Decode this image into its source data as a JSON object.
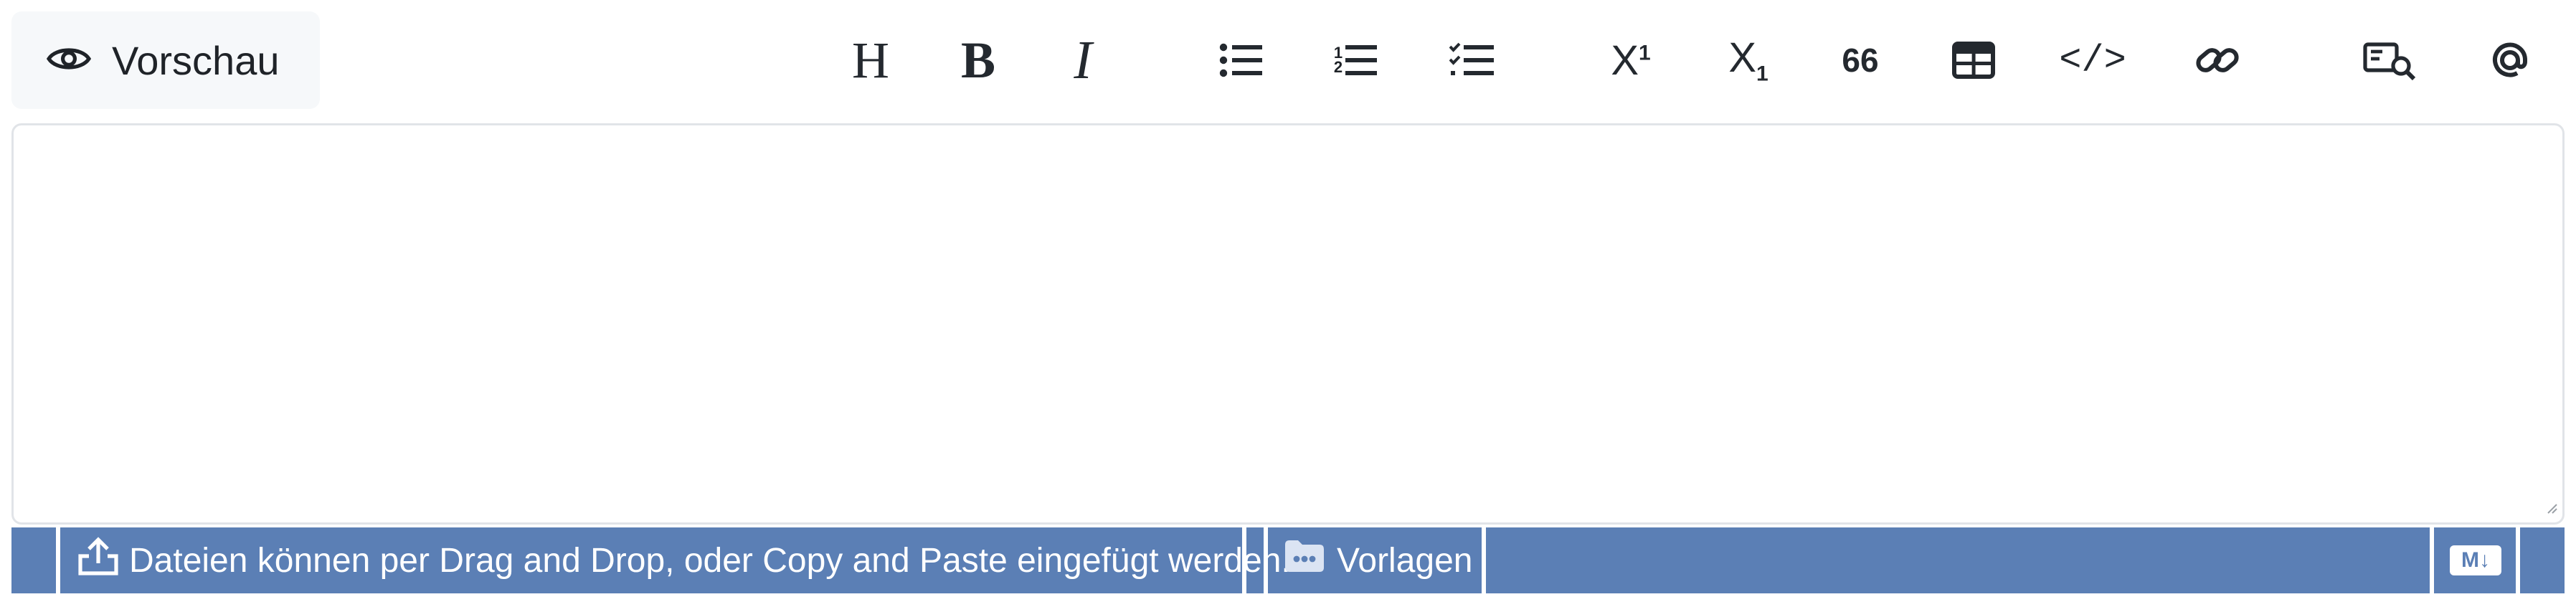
{
  "preview": {
    "label": "Vorschau",
    "icon": "eye-icon"
  },
  "toolbar": {
    "heading": {
      "glyph": "H",
      "icon": "heading-icon"
    },
    "bold": {
      "glyph": "B",
      "icon": "bold-icon"
    },
    "italic": {
      "glyph": "I",
      "icon": "italic-icon"
    },
    "superscript": {
      "base": "X",
      "sup": "1",
      "icon": "superscript-icon"
    },
    "subscript": {
      "base": "X",
      "sub": "1",
      "icon": "subscript-icon"
    },
    "quote": {
      "glyph": "66",
      "icon": "quote-icon"
    },
    "ordered_list_numbers": [
      "1",
      "2"
    ],
    "code": {
      "glyph": "</>",
      "icon": "code-icon"
    }
  },
  "editor": {
    "value": "",
    "placeholder": ""
  },
  "statusbar": {
    "upload_hint": "Dateien können per Drag and Drop, oder Copy and Paste eingefügt werden.",
    "templates_label": "Vorlagen",
    "markdown_badge": "M↓",
    "background_color": "#5b7fb5"
  }
}
